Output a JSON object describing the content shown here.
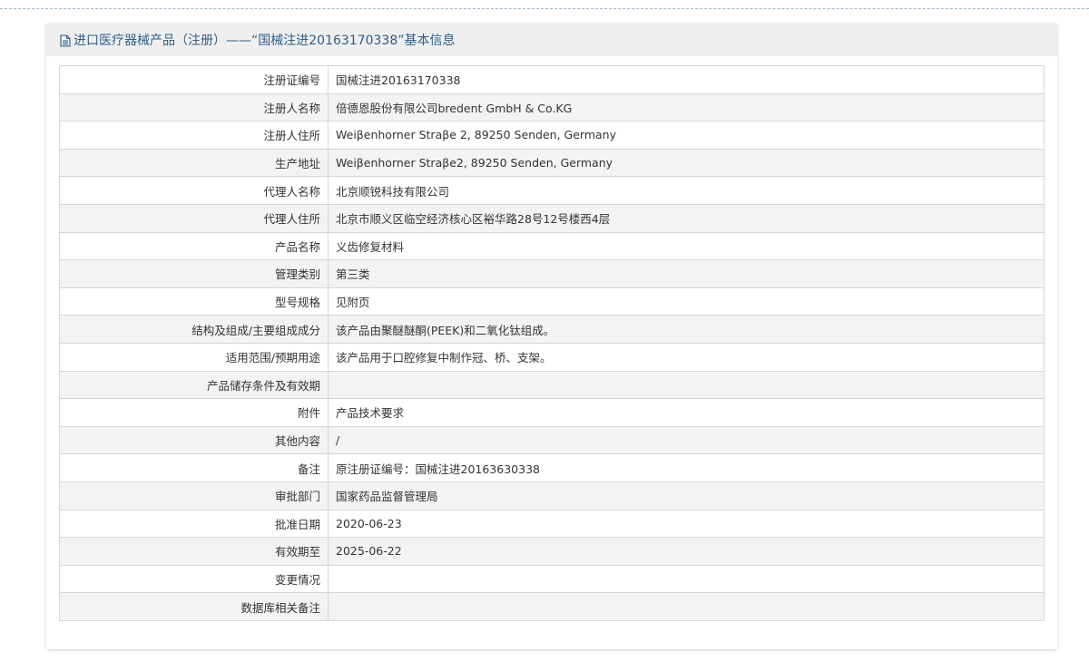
{
  "header": {
    "title": "进口医疗器械产品（注册）——“国械注进20163170338”基本信息",
    "icon": "document-icon"
  },
  "rows": [
    {
      "label": "注册证编号",
      "value": "国械注进20163170338"
    },
    {
      "label": "注册人名称",
      "value": "倍德恩股份有限公司bredent GmbH & Co.KG"
    },
    {
      "label": "注册人住所",
      "value": "Weiβenhorner Straβe 2, 89250 Senden, Germany"
    },
    {
      "label": "生产地址",
      "value": "Weiβenhorner Straβe2, 89250 Senden, Germany"
    },
    {
      "label": "代理人名称",
      "value": "北京顺锐科技有限公司"
    },
    {
      "label": "代理人住所",
      "value": "北京市顺义区临空经济核心区裕华路28号12号楼西4层"
    },
    {
      "label": "产品名称",
      "value": "义齿修复材料"
    },
    {
      "label": "管理类别",
      "value": "第三类"
    },
    {
      "label": "型号规格",
      "value": "见附页"
    },
    {
      "label": "结构及组成/主要组成成分",
      "value": "该产品由聚醚醚酮(PEEK)和二氧化钛组成。"
    },
    {
      "label": "适用范围/预期用途",
      "value": "该产品用于口腔修复中制作冠、桥、支架。"
    },
    {
      "label": "产品储存条件及有效期",
      "value": ""
    },
    {
      "label": "附件",
      "value": "产品技术要求"
    },
    {
      "label": "其他内容",
      "value": "/"
    },
    {
      "label": "备注",
      "value": "原注册证编号：国械注进20163630338"
    },
    {
      "label": "审批部门",
      "value": "国家药品监督管理局"
    },
    {
      "label": "批准日期",
      "value": "2020-06-23"
    },
    {
      "label": "有效期至",
      "value": "2025-06-22"
    },
    {
      "label": "变更情况",
      "value": ""
    },
    {
      "label": "数据库相关备注",
      "value": ""
    }
  ],
  "colors": {
    "title": "#2f5d8a",
    "header_bg": "#efefef",
    "border": "#d6d6d6",
    "stripe": "#f3f3f3"
  }
}
